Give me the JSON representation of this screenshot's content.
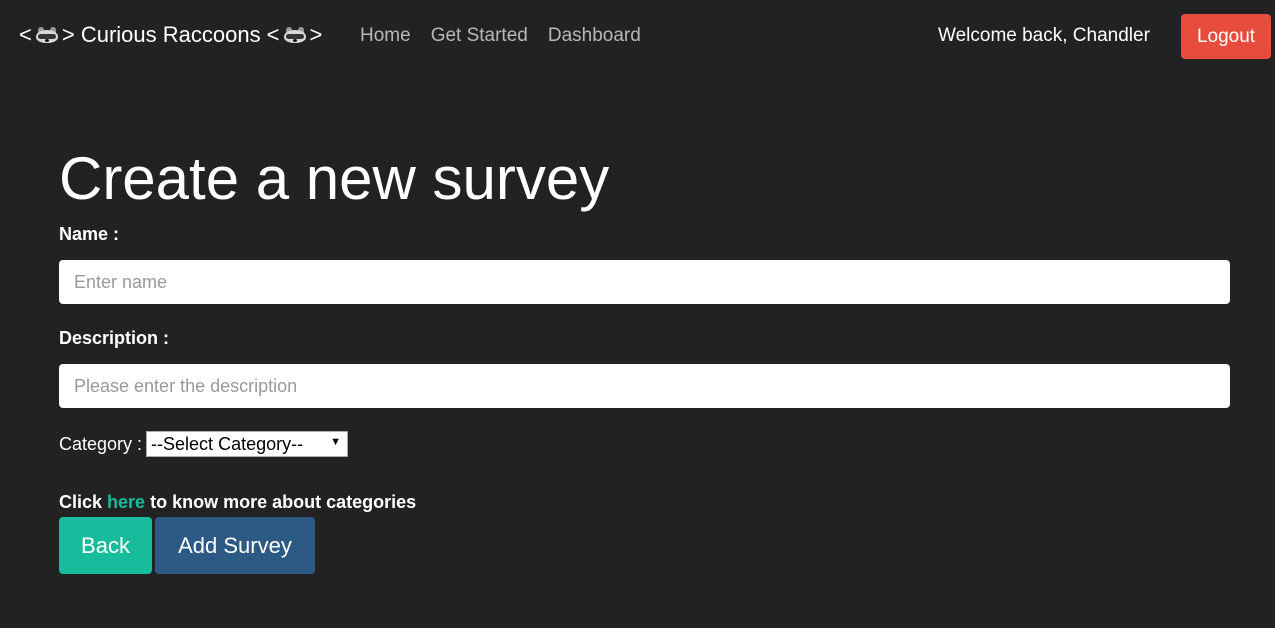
{
  "navbar": {
    "brand": {
      "prefix": "<",
      "middle": "> Curious Raccoons <",
      "suffix": ">",
      "icon": "raccoon-icon"
    },
    "links": [
      {
        "label": "Home"
      },
      {
        "label": "Get Started"
      },
      {
        "label": "Dashboard"
      }
    ],
    "welcome": "Welcome back, Chandler",
    "logout_label": "Logout"
  },
  "form": {
    "title": "Create a new survey",
    "name_label": "Name :",
    "name_placeholder": "Enter name",
    "description_label": "Description :",
    "description_placeholder": "Please enter the description",
    "category_label": "Category :",
    "category_selected": "--Select Category--",
    "info_prefix": "Click",
    "info_link": "here",
    "info_suffix": "to know more about categories",
    "back_label": "Back",
    "add_label": "Add Survey"
  },
  "colors": {
    "background": "#222222",
    "logout": "#e74c3c",
    "back": "#18bc9c",
    "add": "#2c5a84",
    "link": "#18bc9c"
  }
}
